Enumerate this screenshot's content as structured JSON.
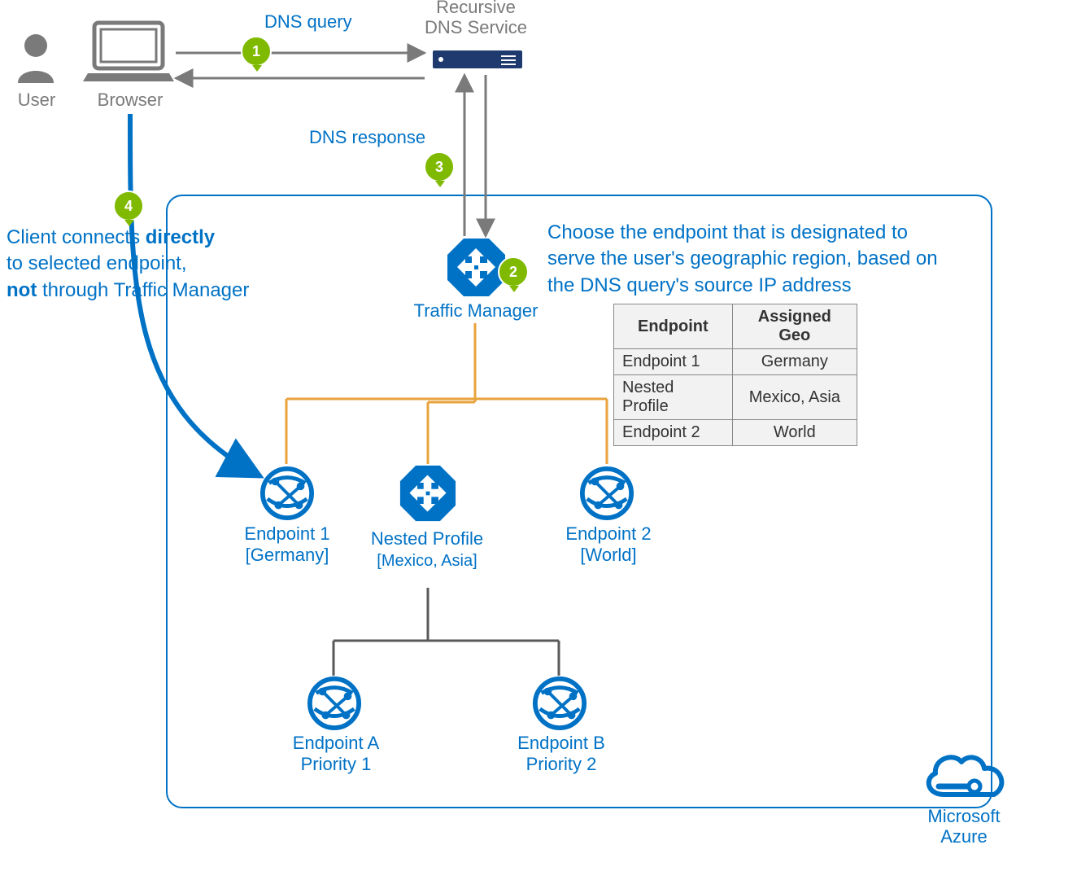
{
  "labels": {
    "user": "User",
    "browser": "Browser",
    "dns_query": "DNS query",
    "recursive_dns1": "Recursive",
    "recursive_dns2": "DNS Service",
    "dns_response": "DNS response",
    "traffic_manager": "Traffic Manager",
    "endpoint1_name": "Endpoint 1",
    "endpoint1_geo": "[Germany]",
    "nested_name": "Nested Profile",
    "nested_geo": "[Mexico, Asia]",
    "endpoint2_name": "Endpoint 2",
    "endpoint2_geo": "[World]",
    "endpointA_name": "Endpoint A",
    "endpointA_pri": "Priority 1",
    "endpointB_name": "Endpoint B",
    "endpointB_pri": "Priority 2",
    "azure1": "Microsoft",
    "azure2": "Azure"
  },
  "steps": {
    "s1": "1",
    "s2": "2",
    "s3": "3",
    "s4": "4"
  },
  "step4_text": {
    "line1a": "Client connects ",
    "line1b": "directly",
    "line2": "to selected endpoint,",
    "line3a": "not",
    "line3b": " through Traffic Manager"
  },
  "routing_text": {
    "line1": "Choose the endpoint that is designated to",
    "line2": "serve the user's geographic region, based on",
    "line3": "the DNS query's source IP address"
  },
  "table": {
    "header_endpoint": "Endpoint",
    "header_geo": "Assigned Geo",
    "rows": [
      {
        "endpoint": "Endpoint 1",
        "geo": "Germany"
      },
      {
        "endpoint": "Nested Profile",
        "geo": "Mexico, Asia"
      },
      {
        "endpoint": "Endpoint 2",
        "geo": "World"
      }
    ]
  }
}
